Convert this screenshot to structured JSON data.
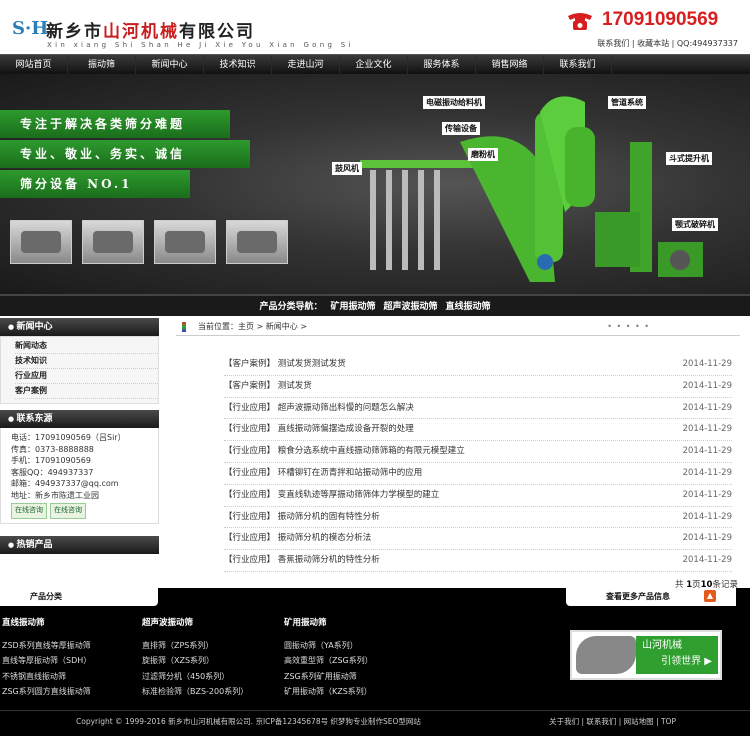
{
  "header": {
    "logo_mark": "S·H",
    "company_name_black": "新乡市",
    "company_name_red": "山河机械",
    "company_name_suffix": "有限公司",
    "pinyin": "Xin xiang Shi Shan He Ji Xie You Xian Gong Si",
    "phone": "17091090569",
    "top_links": "联系我们 | 收藏本站 | QQ:494937337"
  },
  "nav": [
    "网站首页",
    "振动筛",
    "新闻中心",
    "技术知识",
    "走进山河",
    "企业文化",
    "服务体系",
    "销售网络",
    "联系我们"
  ],
  "banner": {
    "slogans": [
      "专注于解决各类筛分难题",
      "专业、敬业、务实、诚信",
      "筛分设备 NO.1"
    ],
    "callouts": [
      "电磁振动给料机",
      "管道系统",
      "传输设备",
      "磨粉机",
      "斗式提升机",
      "鼓风机",
      "颚式破碎机"
    ]
  },
  "product_nav": {
    "label": "产品分类导航：",
    "items": [
      "矿用振动筛",
      "超声波振动筛",
      "直线振动筛"
    ]
  },
  "sidebar": {
    "news_title": "新闻中心",
    "news_items": [
      "新闻动态",
      "技术知识",
      "行业应用",
      "客户案例"
    ],
    "contact_title": "联系东源",
    "contact_lines": [
      "电话：17091090569（吕Sir）",
      "传真：0373-8888888",
      "手机：17091090569",
      "客服QQ：494937337",
      "邮箱：494937337@qq.com",
      "地址：新乡市陈遗工业园"
    ],
    "qq_buttons": [
      "在线咨询",
      "在线咨询"
    ],
    "hot_title": "热销产品"
  },
  "breadcrumb": "当前位置：主页 > 新闻中心 >",
  "breadcrumb_dots": "• • • • •",
  "news": [
    {
      "cat": "【客户案例】",
      "title": "测试发货测试发货",
      "date": "2014-11-29"
    },
    {
      "cat": "【客户案例】",
      "title": "测试发货",
      "date": "2014-11-29"
    },
    {
      "cat": "【行业应用】",
      "title": "超声波振动筛出料慢的问题怎么解决",
      "date": "2014-11-29"
    },
    {
      "cat": "【行业应用】",
      "title": "直线振动筛偏摆造成设备开裂的处理",
      "date": "2014-11-29"
    },
    {
      "cat": "【行业应用】",
      "title": "粮食分选系统中直线振动筛筛箱的有限元模型建立",
      "date": "2014-11-29"
    },
    {
      "cat": "【行业应用】",
      "title": "环槽铆钉在沥青拌和站振动筛中的应用",
      "date": "2014-11-29"
    },
    {
      "cat": "【行业应用】",
      "title": "变直线轨迹等厚振动筛筛体力学模型的建立",
      "date": "2014-11-29"
    },
    {
      "cat": "【行业应用】",
      "title": "振动筛分机的固有特性分析",
      "date": "2014-11-29"
    },
    {
      "cat": "【行业应用】",
      "title": "振动筛分机的模态分析法",
      "date": "2014-11-29"
    },
    {
      "cat": "【行业应用】",
      "title": "香蕉振动筛分机的特性分析",
      "date": "2014-11-29"
    }
  ],
  "pager": {
    "prefix": "共",
    "page": "1",
    "mid": "页",
    "count": "10",
    "suffix": "条记录"
  },
  "bottom": {
    "category_tab": "产品分类",
    "more_tab": "查看更多产品信息",
    "columns": [
      {
        "title": "直线振动筛",
        "items": [
          "ZSD系列直线等厚振动筛",
          "直线等厚振动筛（SDH）",
          "不锈钢直线振动筛",
          "ZSG系列圆方直线振动筛"
        ]
      },
      {
        "title": "超声波振动筛",
        "items": [
          "直排筛（ZPS系列）",
          "旋振筛（XZS系列）",
          "过滤筛分机（450系列）",
          "标准检验筛（BZS-200系列）"
        ]
      },
      {
        "title": "矿用振动筛",
        "items": [
          "圆振动筛（YA系列）",
          "高效重型筛（ZSG系列）",
          "ZSG系列矿用振动筛",
          "矿用振动筛（KZS系列）"
        ]
      }
    ],
    "badge_line1": "山河机械",
    "badge_line2": "引领世界 ▶",
    "copyright": "Copyright © 1999-2016 新乡市山河机械有限公司. 京ICP备12345678号 织梦狗专业制作SEO型网站",
    "footer_links": "关于我们 | 联系我们 | 网站地图 | TOP"
  },
  "colors": {
    "accent_red": "#d81e1e",
    "brand_green": "#2fa02f",
    "nav_bg": "#1a1a1a"
  }
}
